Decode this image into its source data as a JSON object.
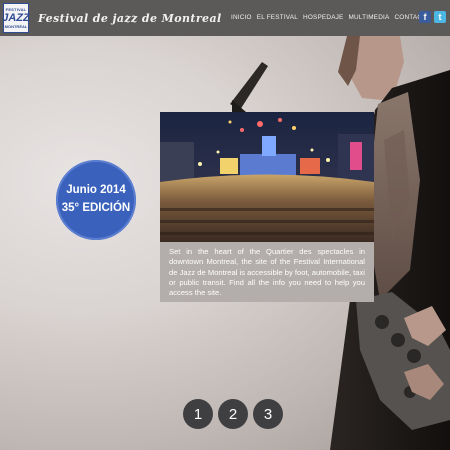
{
  "header": {
    "logo_line1": "FESTIVAL",
    "logo_line2": "JAZZ",
    "logo_line3": "MONTRÉAL",
    "title": "Festival de jazz de Montreal",
    "nav": [
      "INICIO",
      "EL FESTIVAL",
      "HOSPEDAJE",
      "MULTIMEDIA",
      "CONTACTO"
    ],
    "social": {
      "facebook": "f",
      "twitter": "t"
    }
  },
  "badge": {
    "line1": "Junio 2014",
    "line2": "35° EDICIÓN"
  },
  "caption": "Set in the heart of the Quartier des spectacles in downtown Montreal, the site of the Festival International de Jazz de Montreal is accessible by foot, automobile, taxi or public transit. Find all the info you need to help you access the site.",
  "pager": [
    "1",
    "2",
    "3"
  ],
  "colors": {
    "topbar": "#5c5a58",
    "badge": "#3a62bd",
    "pager": "#3f3f42",
    "caption_bg": "#b3adab"
  }
}
